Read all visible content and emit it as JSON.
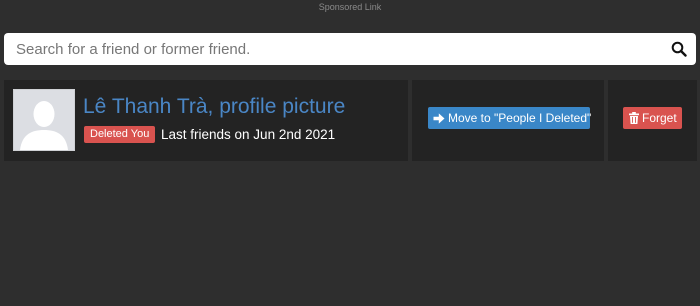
{
  "sponsored_label": "Sponsored Link",
  "search": {
    "placeholder": "Search for a friend or former friend.",
    "value": "",
    "icon": "search-icon"
  },
  "friend": {
    "name": "Lê Thanh Trà, profile picture",
    "status_badge": "Deleted You",
    "last_friends": "Last friends on Jun 2nd 2021",
    "avatar_icon": "default-avatar-icon"
  },
  "actions": {
    "move_label": "Move to \"People I Deleted\"",
    "move_icon": "arrow-right-icon",
    "forget_label": "Forget",
    "forget_icon": "trash-icon"
  },
  "colors": {
    "background": "#2e2e2e",
    "card": "#232323",
    "link": "#4a86c5",
    "danger": "#d9534f",
    "primary": "#3a87c8"
  }
}
